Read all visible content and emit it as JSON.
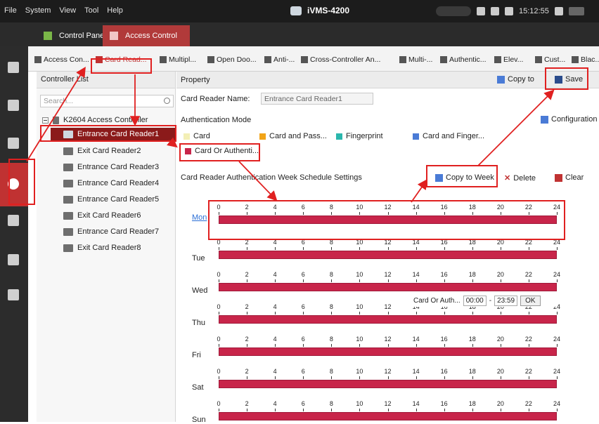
{
  "menu": [
    "File",
    "System",
    "View",
    "Tool",
    "Help"
  ],
  "app_title": "iVMS-4200",
  "clock": "15:12:55",
  "tabs": [
    {
      "label": "Control Panel"
    },
    {
      "label": "Access Control"
    }
  ],
  "toolbar": [
    {
      "label": "Access Con..."
    },
    {
      "label": "Card Read..."
    },
    {
      "label": "Multipl..."
    },
    {
      "label": "Open Doo..."
    },
    {
      "label": "Anti-..."
    },
    {
      "label": "Cross-Controller An..."
    },
    {
      "label": "Multi-..."
    },
    {
      "label": "Authentic..."
    },
    {
      "label": "Elev..."
    },
    {
      "label": "Cust..."
    },
    {
      "label": "Blac..."
    }
  ],
  "controller_list": {
    "title": "Controller List",
    "search_placeholder": "Search...",
    "controller": "K2604 Access Controller",
    "readers": [
      "Entrance Card Reader1",
      "Exit Card Reader2",
      "Entrance Card Reader3",
      "Entrance Card Reader4",
      "Entrance Card Reader5",
      "Exit Card Reader6",
      "Entrance Card Reader7",
      "Exit Card Reader8"
    ]
  },
  "property": {
    "title": "Property",
    "copy_to": "Copy to",
    "save": "Save",
    "reader_name_label": "Card Reader Name:",
    "reader_name_value": "Entrance Card Reader1",
    "auth_mode_label": "Authentication Mode",
    "configuration": "Configuration",
    "modes": [
      {
        "label": "Card",
        "color": "#f3efb6"
      },
      {
        "label": "Card and Pass...",
        "color": "#f2a418"
      },
      {
        "label": "Fingerprint",
        "color": "#2bb7ad"
      },
      {
        "label": "Card and Finger...",
        "color": "#4a7bd6"
      },
      {
        "label": "Card Or Authenti...",
        "color": "#c8254a"
      }
    ],
    "schedule_title": "Card Reader Authentication Week Schedule Settings",
    "copy_to_week": "Copy to Week",
    "delete": "Delete",
    "clear": "Clear",
    "days": [
      "Mon",
      "Tue",
      "Wed",
      "Thu",
      "Fri",
      "Sat",
      "Sun"
    ],
    "hours": [
      "0",
      "2",
      "4",
      "6",
      "8",
      "10",
      "12",
      "14",
      "16",
      "18",
      "20",
      "22",
      "24"
    ],
    "popover": {
      "mode": "Card Or Auth...",
      "start": "00:00",
      "separator": "-",
      "end": "23:59",
      "ok": "OK"
    }
  }
}
